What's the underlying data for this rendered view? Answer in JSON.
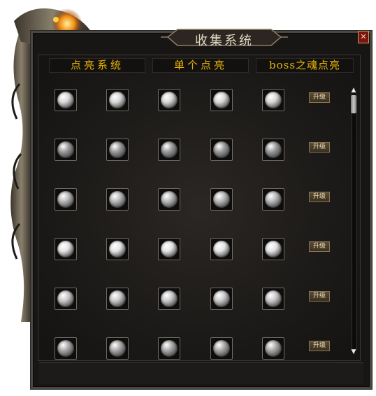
{
  "window": {
    "title": "收集系统"
  },
  "close_glyph": "✕",
  "tabs": [
    {
      "label": "点亮系统"
    },
    {
      "label": "单个点亮"
    },
    {
      "label": "boss之魂点亮"
    }
  ],
  "upgrade_label": "升级",
  "rows": [
    {
      "orb_color": "#d8d8d8",
      "style": "swirl"
    },
    {
      "orb_color": "#9a9a9a",
      "style": "dim"
    },
    {
      "orb_color": "#b8b8b8",
      "style": "mottled"
    },
    {
      "orb_color": "#e4e4e4",
      "style": "bright"
    },
    {
      "orb_color": "#c8c8c8",
      "style": "gloss"
    },
    {
      "orb_color": "#a8a8a8",
      "style": "flower"
    }
  ],
  "icons": {
    "orb": "orb-icon",
    "scroll_up": "scroll-up-arrow-icon",
    "scroll_down": "scroll-down-arrow-icon",
    "dragon": "dragon-decoration-icon"
  },
  "colors": {
    "accent": "#e8b400",
    "frame": "#4a4641"
  }
}
